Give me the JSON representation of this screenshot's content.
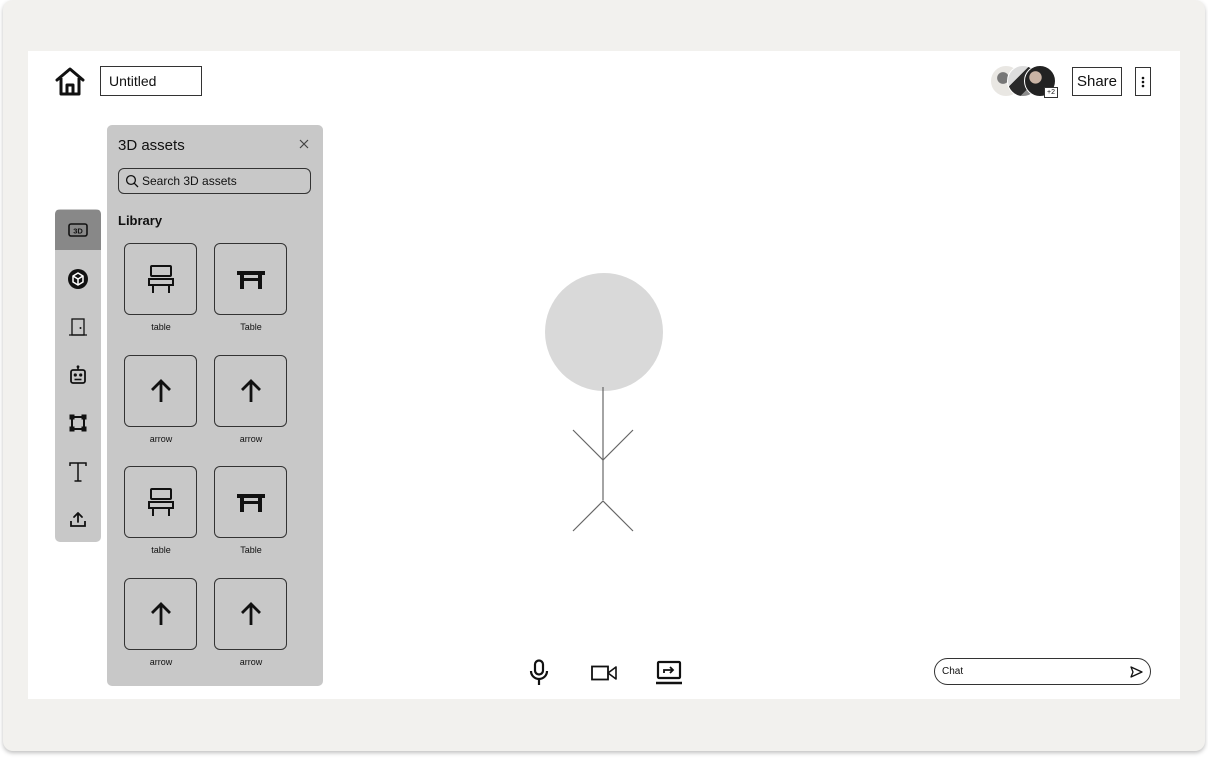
{
  "header": {
    "document_title": "Untitled",
    "share_label": "Share",
    "collaborators_extra": "+2"
  },
  "toolbar": {
    "items": [
      {
        "icon": "3d-assets-icon",
        "label": "3D",
        "active": true
      },
      {
        "icon": "cube-icon"
      },
      {
        "icon": "door-icon"
      },
      {
        "icon": "robot-icon"
      },
      {
        "icon": "shape-icon"
      },
      {
        "icon": "text-icon"
      },
      {
        "icon": "upload-icon"
      }
    ]
  },
  "assets_panel": {
    "title": "3D assets",
    "search_placeholder": "Search 3D assets",
    "section_label": "Library",
    "items": [
      {
        "name": "table",
        "icon": "chair-icon"
      },
      {
        "name": "Table",
        "icon": "table-icon"
      },
      {
        "name": "arrow",
        "icon": "arrow-up-icon"
      },
      {
        "name": "arrow",
        "icon": "arrow-up-icon"
      },
      {
        "name": "table",
        "icon": "chair-icon"
      },
      {
        "name": "Table",
        "icon": "table-icon"
      },
      {
        "name": "arrow",
        "icon": "arrow-up-icon"
      },
      {
        "name": "arrow",
        "icon": "arrow-up-icon"
      }
    ]
  },
  "controls": {
    "buttons": [
      "microphone-icon",
      "video-camera-icon",
      "screen-share-icon"
    ]
  },
  "chat": {
    "placeholder": "Chat"
  },
  "colors": {
    "frame": "#f2f1ee",
    "panel": "#c8c8c8",
    "active_tool": "#888888",
    "figure_head": "#d9d9d9"
  }
}
